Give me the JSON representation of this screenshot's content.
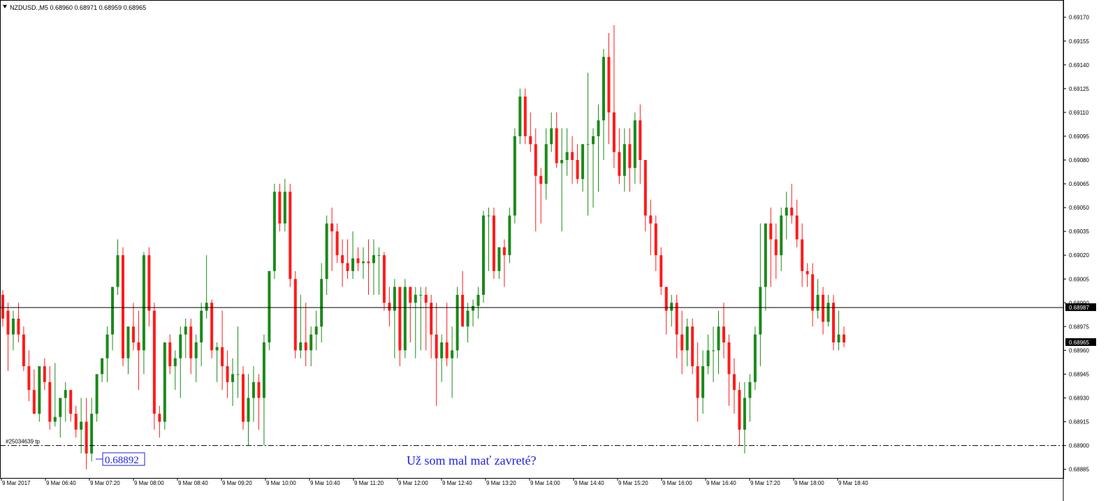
{
  "header": {
    "symbol_line": "NZDUSD.,M5  0.68960 0.68971 0.68959 0.68965"
  },
  "price_axis": {
    "ticks": [
      "0.69170",
      "0.69155",
      "0.69140",
      "0.69125",
      "0.69110",
      "0.69095",
      "0.69080",
      "0.69065",
      "0.69050",
      "0.69035",
      "0.69020",
      "0.69005",
      "0.68990",
      "0.68975",
      "0.68960",
      "0.68945",
      "0.68930",
      "0.68915",
      "0.68900",
      "0.68885"
    ],
    "current_price_tag": "0.68965",
    "hline_tag": "0.68987"
  },
  "time_axis": {
    "labels": [
      "9 Mar 2017",
      "9 Mar 06:40",
      "9 Mar 07:20",
      "9 Mar 08:00",
      "9 Mar 08:40",
      "9 Mar 09:20",
      "9 Mar 10:00",
      "9 Mar 10:40",
      "9 Mar 11:20",
      "9 Mar 12:00",
      "9 Mar 12:40",
      "9 Mar 13:20",
      "9 Mar 14:00",
      "9 Mar 14:40",
      "9 Mar 15:20",
      "9 Mar 16:00",
      "9 Mar 16:40",
      "9 Mar 17:20",
      "9 Mar 18:00",
      "9 Mar 18:40"
    ]
  },
  "annotations": {
    "tp_label": "#25034639 tp",
    "price_label": "0.68892",
    "comment": "Už som mal mať zavreté?"
  },
  "colors": {
    "bull": "#1a8a1a",
    "bear": "#ff1a1a",
    "text_blue": "#1f1fe6"
  },
  "chart_data": {
    "type": "candlestick",
    "timeframe": "M5",
    "ylim": [
      0.6888,
      0.6918
    ],
    "hline_price": 0.68987,
    "tp_level": 0.689,
    "current_price": 0.68965,
    "ohlc": [
      [
        0.68995,
        0.68998,
        0.68975,
        0.6898
      ],
      [
        0.68985,
        0.6899,
        0.68947,
        0.6897
      ],
      [
        0.6897,
        0.68985,
        0.6896,
        0.6898
      ],
      [
        0.6898,
        0.6899,
        0.68965,
        0.6897
      ],
      [
        0.6897,
        0.68975,
        0.68947,
        0.6895
      ],
      [
        0.6895,
        0.6896,
        0.68928,
        0.68935
      ],
      [
        0.68935,
        0.68948,
        0.6892,
        0.6892
      ],
      [
        0.6892,
        0.6895,
        0.68915,
        0.6895
      ],
      [
        0.6895,
        0.68955,
        0.68935,
        0.6894
      ],
      [
        0.6894,
        0.6895,
        0.6891,
        0.68915
      ],
      [
        0.68915,
        0.68952,
        0.68912,
        0.68918
      ],
      [
        0.68918,
        0.6893,
        0.68905,
        0.6893
      ],
      [
        0.6893,
        0.6894,
        0.68915,
        0.68935
      ],
      [
        0.68935,
        0.68935,
        0.68915,
        0.6892
      ],
      [
        0.6892,
        0.68925,
        0.68905,
        0.6891
      ],
      [
        0.6891,
        0.6893,
        0.68895,
        0.68915
      ],
      [
        0.68915,
        0.6893,
        0.68885,
        0.68895
      ],
      [
        0.68895,
        0.6893,
        0.6889,
        0.6892
      ],
      [
        0.6892,
        0.68945,
        0.68915,
        0.68945
      ],
      [
        0.68945,
        0.68955,
        0.6894,
        0.68955
      ],
      [
        0.68955,
        0.68975,
        0.6894,
        0.6897
      ],
      [
        0.6897,
        0.69,
        0.6896,
        0.69
      ],
      [
        0.69,
        0.6903,
        0.68995,
        0.6902
      ],
      [
        0.6902,
        0.69025,
        0.6895,
        0.68955
      ],
      [
        0.68955,
        0.68975,
        0.68945,
        0.68975
      ],
      [
        0.68975,
        0.6899,
        0.6896,
        0.68965
      ],
      [
        0.68965,
        0.68985,
        0.68935,
        0.6896
      ],
      [
        0.6896,
        0.69022,
        0.68945,
        0.6902
      ],
      [
        0.6902,
        0.69025,
        0.68975,
        0.68985
      ],
      [
        0.68985,
        0.6899,
        0.6891,
        0.6892
      ],
      [
        0.6892,
        0.68925,
        0.68905,
        0.68915
      ],
      [
        0.68915,
        0.68965,
        0.6891,
        0.68965
      ],
      [
        0.68965,
        0.6897,
        0.68945,
        0.6895
      ],
      [
        0.6895,
        0.6896,
        0.68935,
        0.68955
      ],
      [
        0.68955,
        0.68975,
        0.6893,
        0.6897
      ],
      [
        0.6897,
        0.6898,
        0.68955,
        0.68975
      ],
      [
        0.68975,
        0.6898,
        0.68945,
        0.68955
      ],
      [
        0.68955,
        0.6897,
        0.6894,
        0.68965
      ],
      [
        0.68965,
        0.6899,
        0.6895,
        0.68985
      ],
      [
        0.68985,
        0.6902,
        0.6898,
        0.6899
      ],
      [
        0.6899,
        0.68992,
        0.68955,
        0.6896
      ],
      [
        0.6896,
        0.68965,
        0.6894,
        0.68962
      ],
      [
        0.68962,
        0.68985,
        0.68935,
        0.6895
      ],
      [
        0.6895,
        0.6896,
        0.6893,
        0.6894
      ],
      [
        0.6894,
        0.68955,
        0.68925,
        0.68945
      ],
      [
        0.68945,
        0.68975,
        0.6893,
        0.68945
      ],
      [
        0.68945,
        0.6895,
        0.6891,
        0.68915
      ],
      [
        0.68915,
        0.68945,
        0.689,
        0.6893
      ],
      [
        0.6893,
        0.6895,
        0.68915,
        0.6894
      ],
      [
        0.6894,
        0.68945,
        0.6891,
        0.6893
      ],
      [
        0.6893,
        0.6897,
        0.689,
        0.68965
      ],
      [
        0.68965,
        0.6901,
        0.6896,
        0.6901
      ],
      [
        0.6901,
        0.69065,
        0.69005,
        0.6906
      ],
      [
        0.6906,
        0.69065,
        0.69035,
        0.6904
      ],
      [
        0.6904,
        0.69068,
        0.69035,
        0.6906
      ],
      [
        0.6906,
        0.69065,
        0.69,
        0.69005
      ],
      [
        0.69005,
        0.6901,
        0.68955,
        0.6896
      ],
      [
        0.6896,
        0.68995,
        0.68955,
        0.68965
      ],
      [
        0.68965,
        0.6899,
        0.6895,
        0.6896
      ],
      [
        0.6896,
        0.68975,
        0.6895,
        0.6897
      ],
      [
        0.6897,
        0.68985,
        0.6896,
        0.68975
      ],
      [
        0.68975,
        0.69015,
        0.68965,
        0.69005
      ],
      [
        0.69005,
        0.69045,
        0.68995,
        0.6904
      ],
      [
        0.6904,
        0.6905,
        0.6901,
        0.69035
      ],
      [
        0.69035,
        0.6904,
        0.69015,
        0.6902
      ],
      [
        0.6902,
        0.6903,
        0.69,
        0.69015
      ],
      [
        0.69015,
        0.6903,
        0.69005,
        0.6901
      ],
      [
        0.6901,
        0.69035,
        0.69005,
        0.69018
      ],
      [
        0.69018,
        0.69025,
        0.6901,
        0.69015
      ],
      [
        0.69015,
        0.69025,
        0.69005,
        0.69016
      ],
      [
        0.69016,
        0.6903,
        0.68995,
        0.69015
      ],
      [
        0.69015,
        0.6903,
        0.68995,
        0.6902
      ],
      [
        0.6902,
        0.69025,
        0.68995,
        0.6902
      ],
      [
        0.6902,
        0.69022,
        0.68985,
        0.6899
      ],
      [
        0.6899,
        0.69,
        0.68975,
        0.68985
      ],
      [
        0.68985,
        0.69005,
        0.68955,
        0.69
      ],
      [
        0.69,
        0.69,
        0.6895,
        0.6896
      ],
      [
        0.6896,
        0.69005,
        0.68955,
        0.69
      ],
      [
        0.69,
        0.69,
        0.68965,
        0.6899
      ],
      [
        0.6899,
        0.69,
        0.68955,
        0.68995
      ],
      [
        0.68995,
        0.69,
        0.6896,
        0.68995
      ],
      [
        0.68995,
        0.69,
        0.6896,
        0.6899
      ],
      [
        0.6899,
        0.68995,
        0.68955,
        0.6897
      ],
      [
        0.6897,
        0.6899,
        0.68925,
        0.68955
      ],
      [
        0.68955,
        0.6897,
        0.6894,
        0.68965
      ],
      [
        0.68965,
        0.6899,
        0.6895,
        0.68955
      ],
      [
        0.68955,
        0.68975,
        0.6893,
        0.6896
      ],
      [
        0.6896,
        0.69,
        0.68955,
        0.68995
      ],
      [
        0.68995,
        0.6901,
        0.68975,
        0.68975
      ],
      [
        0.68975,
        0.6899,
        0.68965,
        0.68985
      ],
      [
        0.68985,
        0.68992,
        0.68975,
        0.68988
      ],
      [
        0.68988,
        0.69,
        0.6898,
        0.68995
      ],
      [
        0.68995,
        0.69048,
        0.6899,
        0.69045
      ],
      [
        0.69045,
        0.6905,
        0.6901,
        0.69045
      ],
      [
        0.69045,
        0.6905,
        0.69005,
        0.6901
      ],
      [
        0.6901,
        0.69025,
        0.69005,
        0.69025
      ],
      [
        0.69025,
        0.6903,
        0.69,
        0.6902
      ],
      [
        0.6902,
        0.6905,
        0.69015,
        0.69045
      ],
      [
        0.69045,
        0.691,
        0.6904,
        0.69095
      ],
      [
        0.69095,
        0.69125,
        0.6909,
        0.6912
      ],
      [
        0.6912,
        0.69125,
        0.6909,
        0.69095
      ],
      [
        0.69095,
        0.6911,
        0.69085,
        0.6909
      ],
      [
        0.6909,
        0.691,
        0.69035,
        0.6907
      ],
      [
        0.6907,
        0.69075,
        0.6904,
        0.69065
      ],
      [
        0.69065,
        0.691,
        0.69055,
        0.6909
      ],
      [
        0.6909,
        0.6911,
        0.69085,
        0.691
      ],
      [
        0.691,
        0.6911,
        0.69075,
        0.69078
      ],
      [
        0.69078,
        0.691,
        0.69035,
        0.6908
      ],
      [
        0.6908,
        0.691,
        0.6907,
        0.69085
      ],
      [
        0.69085,
        0.69095,
        0.69065,
        0.6908
      ],
      [
        0.6908,
        0.6909,
        0.69065,
        0.69068
      ],
      [
        0.69068,
        0.6909,
        0.6906,
        0.6909
      ],
      [
        0.6909,
        0.69135,
        0.69045,
        0.6909
      ],
      [
        0.6909,
        0.691,
        0.6905,
        0.69095
      ],
      [
        0.69095,
        0.69115,
        0.6906,
        0.69105
      ],
      [
        0.69105,
        0.6915,
        0.6908,
        0.69145
      ],
      [
        0.69145,
        0.6916,
        0.6909,
        0.6911
      ],
      [
        0.6911,
        0.69165,
        0.69075,
        0.69085
      ],
      [
        0.69085,
        0.691,
        0.69065,
        0.6907
      ],
      [
        0.6907,
        0.691,
        0.6906,
        0.6909
      ],
      [
        0.6909,
        0.691,
        0.6906,
        0.69075
      ],
      [
        0.69075,
        0.6911,
        0.69065,
        0.69105
      ],
      [
        0.69105,
        0.69115,
        0.69065,
        0.6908
      ],
      [
        0.6908,
        0.6908,
        0.69035,
        0.69045
      ],
      [
        0.69045,
        0.69055,
        0.6902,
        0.6904
      ],
      [
        0.6904,
        0.69045,
        0.6901,
        0.6902
      ],
      [
        0.6902,
        0.69025,
        0.68995,
        0.69
      ],
      [
        0.69,
        0.69,
        0.6897,
        0.68985
      ],
      [
        0.68985,
        0.68995,
        0.68975,
        0.6899
      ],
      [
        0.6899,
        0.68995,
        0.68955,
        0.6897
      ],
      [
        0.6897,
        0.68985,
        0.68945,
        0.6896
      ],
      [
        0.6896,
        0.6898,
        0.6895,
        0.68975
      ],
      [
        0.68975,
        0.6898,
        0.68945,
        0.6895
      ],
      [
        0.6895,
        0.68965,
        0.68915,
        0.6893
      ],
      [
        0.6893,
        0.6896,
        0.6892,
        0.6895
      ],
      [
        0.6895,
        0.6897,
        0.68945,
        0.6896
      ],
      [
        0.6896,
        0.68975,
        0.6894,
        0.6896
      ],
      [
        0.6896,
        0.68985,
        0.68945,
        0.68975
      ],
      [
        0.68975,
        0.6899,
        0.68955,
        0.68965
      ],
      [
        0.68965,
        0.6897,
        0.68925,
        0.68945
      ],
      [
        0.68945,
        0.68955,
        0.6892,
        0.68935
      ],
      [
        0.68935,
        0.6894,
        0.689,
        0.6891
      ],
      [
        0.6891,
        0.6894,
        0.68895,
        0.6893
      ],
      [
        0.6893,
        0.68945,
        0.68915,
        0.6894
      ],
      [
        0.6894,
        0.68975,
        0.68935,
        0.6897
      ],
      [
        0.6897,
        0.6904,
        0.6895,
        0.69
      ],
      [
        0.69,
        0.6904,
        0.68985,
        0.6904
      ],
      [
        0.6904,
        0.6905,
        0.69,
        0.6903
      ],
      [
        0.6903,
        0.6904,
        0.69005,
        0.6902
      ],
      [
        0.6902,
        0.6905,
        0.6901,
        0.69045
      ],
      [
        0.69045,
        0.6906,
        0.6903,
        0.6905
      ],
      [
        0.6905,
        0.69065,
        0.6904,
        0.69045
      ],
      [
        0.69045,
        0.69055,
        0.69025,
        0.6903
      ],
      [
        0.6903,
        0.6904,
        0.69,
        0.6901
      ],
      [
        0.6901,
        0.69015,
        0.69,
        0.69008
      ],
      [
        0.69008,
        0.69015,
        0.68975,
        0.68985
      ],
      [
        0.68985,
        0.69005,
        0.6898,
        0.68995
      ],
      [
        0.68995,
        0.69,
        0.6897,
        0.68978
      ],
      [
        0.68978,
        0.68995,
        0.68975,
        0.6899
      ],
      [
        0.6899,
        0.68995,
        0.6896,
        0.68965
      ],
      [
        0.68965,
        0.68985,
        0.6896,
        0.6897
      ],
      [
        0.6897,
        0.68975,
        0.68962,
        0.68965
      ]
    ]
  }
}
